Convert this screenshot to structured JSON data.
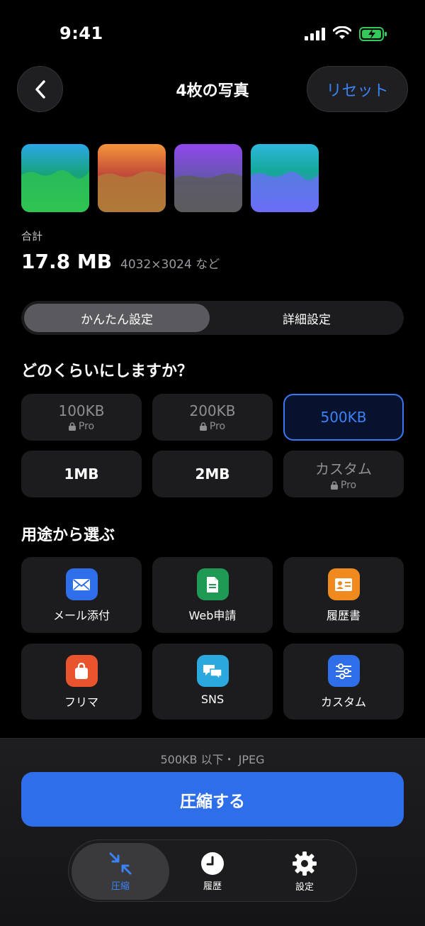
{
  "status": {
    "time": "9:41"
  },
  "header": {
    "title": "4枚の写真",
    "reset_label": "リセット"
  },
  "thumbnails": [
    {
      "name": "photo-1",
      "colors": [
        "#2fa3e0",
        "#1fb56a",
        "#34d058"
      ]
    },
    {
      "name": "photo-2",
      "colors": [
        "#f0913a",
        "#c0483a",
        "#a87a3c"
      ]
    },
    {
      "name": "photo-3",
      "colors": [
        "#8d4ae6",
        "#6b57b8",
        "#5f5f62"
      ]
    },
    {
      "name": "photo-4",
      "colors": [
        "#2bb4d8",
        "#17a89a",
        "#6b6ef5"
      ]
    }
  ],
  "summary": {
    "label": "合計",
    "size": "17.8 MB",
    "detail": "4032×3024 など"
  },
  "mode_segment": {
    "simple": "かんたん設定",
    "detail": "詳細設定"
  },
  "size_section": {
    "title": "どのくらいにしますか？"
  },
  "sizes": [
    {
      "label": "100KB",
      "sub": "Pro",
      "locked": true
    },
    {
      "label": "200KB",
      "sub": "Pro",
      "locked": true
    },
    {
      "label": "500KB",
      "sub": "",
      "locked": false,
      "selected": true
    },
    {
      "label": "1MB",
      "sub": "",
      "locked": false
    },
    {
      "label": "2MB",
      "sub": "",
      "locked": false
    },
    {
      "label": "カスタム",
      "sub": "Pro",
      "locked": true
    }
  ],
  "purpose_section": {
    "title": "用途から選ぶ"
  },
  "purposes": [
    {
      "label": "メール添付",
      "icon": "mail-icon",
      "color": "#2f6ee9"
    },
    {
      "label": "Web申請",
      "icon": "document-icon",
      "color": "#1f9a55"
    },
    {
      "label": "履歴書",
      "icon": "id-card-icon",
      "color": "#f08a1e"
    },
    {
      "label": "フリマ",
      "icon": "shopping-bag-icon",
      "color": "#e8542e"
    },
    {
      "label": "SNS",
      "icon": "chat-bubbles-icon",
      "color": "#2ba8de"
    },
    {
      "label": "カスタム",
      "icon": "sliders-icon",
      "color": "#2f6ee9"
    }
  ],
  "footer": {
    "format_note": "500KB 以下・ JPEG",
    "compress_label": "圧縮する"
  },
  "tabbar": {
    "compress": "圧縮",
    "history": "履歴",
    "settings": "設定"
  },
  "colors": {
    "accent": "#2f6ee9",
    "accent_text": "#3b82f6"
  }
}
